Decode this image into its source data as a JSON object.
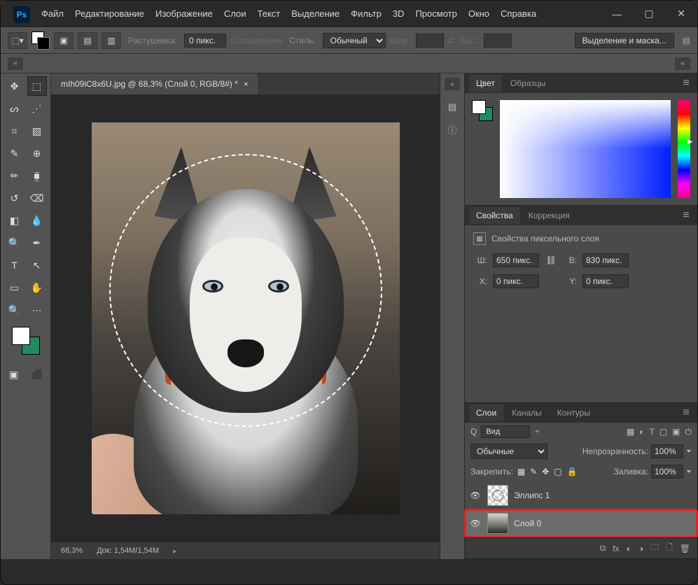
{
  "app": {
    "logo_text": "Ps"
  },
  "menu": [
    "Файл",
    "Редактирование",
    "Изображение",
    "Слои",
    "Текст",
    "Выделение",
    "Фильтр",
    "3D",
    "Просмотр",
    "Окно",
    "Справка"
  ],
  "options": {
    "feather_label": "Растушевка:",
    "feather_value": "0 пикс.",
    "antialias": "Сглаживание",
    "style_label": "Стиль:",
    "style_value": "Обычный",
    "width_label": "Шир.:",
    "height_label": "Выс.:",
    "select_mask": "Выделение и маска..."
  },
  "document": {
    "tab_title": "mIh09iC8x6U.jpg @ 68,3% (Слой 0, RGB/8#) *",
    "zoom": "68,3%",
    "doc_size_label": "Док:",
    "doc_size": "1,54M/1,54M"
  },
  "panels": {
    "color": {
      "tab1": "Цвет",
      "tab2": "Образцы"
    },
    "properties": {
      "tab1": "Свойства",
      "tab2": "Коррекция",
      "title": "Свойства пиксельного слоя",
      "w_label": "Ш:",
      "w_value": "650 пикс.",
      "h_label": "В:",
      "h_value": "830 пикс.",
      "x_label": "X:",
      "x_value": "0 пикс.",
      "y_label": "Y:",
      "y_value": "0 пикс."
    },
    "layers": {
      "tab1": "Слои",
      "tab2": "Каналы",
      "tab3": "Контуры",
      "search_prefix": "Q",
      "search_value": "Вид",
      "blend": "Обычные",
      "opacity_label": "Непрозрачность:",
      "opacity_value": "100%",
      "lock_label": "Закрепить:",
      "fill_label": "Заливка:",
      "fill_value": "100%",
      "layer1": "Эллипс 1",
      "layer2": "Слой 0"
    }
  }
}
